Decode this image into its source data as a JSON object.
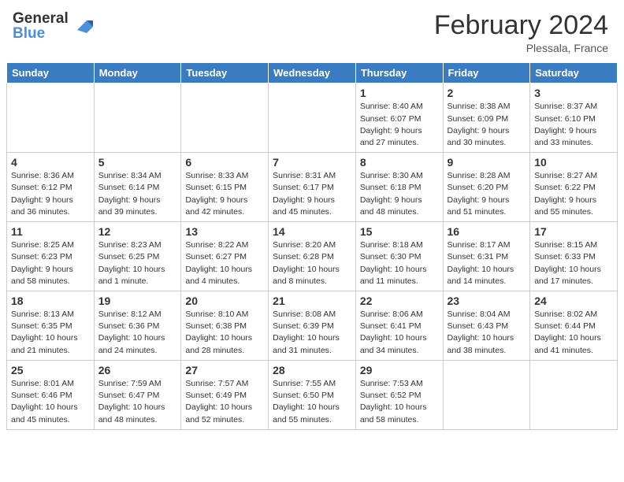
{
  "header": {
    "logo_general": "General",
    "logo_blue": "Blue",
    "title": "February 2024",
    "subtitle": "Plessala, France"
  },
  "calendar": {
    "days_of_week": [
      "Sunday",
      "Monday",
      "Tuesday",
      "Wednesday",
      "Thursday",
      "Friday",
      "Saturday"
    ],
    "weeks": [
      [
        {
          "day": "",
          "info": ""
        },
        {
          "day": "",
          "info": ""
        },
        {
          "day": "",
          "info": ""
        },
        {
          "day": "",
          "info": ""
        },
        {
          "day": "1",
          "info": "Sunrise: 8:40 AM\nSunset: 6:07 PM\nDaylight: 9 hours\nand 27 minutes."
        },
        {
          "day": "2",
          "info": "Sunrise: 8:38 AM\nSunset: 6:09 PM\nDaylight: 9 hours\nand 30 minutes."
        },
        {
          "day": "3",
          "info": "Sunrise: 8:37 AM\nSunset: 6:10 PM\nDaylight: 9 hours\nand 33 minutes."
        }
      ],
      [
        {
          "day": "4",
          "info": "Sunrise: 8:36 AM\nSunset: 6:12 PM\nDaylight: 9 hours\nand 36 minutes."
        },
        {
          "day": "5",
          "info": "Sunrise: 8:34 AM\nSunset: 6:14 PM\nDaylight: 9 hours\nand 39 minutes."
        },
        {
          "day": "6",
          "info": "Sunrise: 8:33 AM\nSunset: 6:15 PM\nDaylight: 9 hours\nand 42 minutes."
        },
        {
          "day": "7",
          "info": "Sunrise: 8:31 AM\nSunset: 6:17 PM\nDaylight: 9 hours\nand 45 minutes."
        },
        {
          "day": "8",
          "info": "Sunrise: 8:30 AM\nSunset: 6:18 PM\nDaylight: 9 hours\nand 48 minutes."
        },
        {
          "day": "9",
          "info": "Sunrise: 8:28 AM\nSunset: 6:20 PM\nDaylight: 9 hours\nand 51 minutes."
        },
        {
          "day": "10",
          "info": "Sunrise: 8:27 AM\nSunset: 6:22 PM\nDaylight: 9 hours\nand 55 minutes."
        }
      ],
      [
        {
          "day": "11",
          "info": "Sunrise: 8:25 AM\nSunset: 6:23 PM\nDaylight: 9 hours\nand 58 minutes."
        },
        {
          "day": "12",
          "info": "Sunrise: 8:23 AM\nSunset: 6:25 PM\nDaylight: 10 hours\nand 1 minute."
        },
        {
          "day": "13",
          "info": "Sunrise: 8:22 AM\nSunset: 6:27 PM\nDaylight: 10 hours\nand 4 minutes."
        },
        {
          "day": "14",
          "info": "Sunrise: 8:20 AM\nSunset: 6:28 PM\nDaylight: 10 hours\nand 8 minutes."
        },
        {
          "day": "15",
          "info": "Sunrise: 8:18 AM\nSunset: 6:30 PM\nDaylight: 10 hours\nand 11 minutes."
        },
        {
          "day": "16",
          "info": "Sunrise: 8:17 AM\nSunset: 6:31 PM\nDaylight: 10 hours\nand 14 minutes."
        },
        {
          "day": "17",
          "info": "Sunrise: 8:15 AM\nSunset: 6:33 PM\nDaylight: 10 hours\nand 17 minutes."
        }
      ],
      [
        {
          "day": "18",
          "info": "Sunrise: 8:13 AM\nSunset: 6:35 PM\nDaylight: 10 hours\nand 21 minutes."
        },
        {
          "day": "19",
          "info": "Sunrise: 8:12 AM\nSunset: 6:36 PM\nDaylight: 10 hours\nand 24 minutes."
        },
        {
          "day": "20",
          "info": "Sunrise: 8:10 AM\nSunset: 6:38 PM\nDaylight: 10 hours\nand 28 minutes."
        },
        {
          "day": "21",
          "info": "Sunrise: 8:08 AM\nSunset: 6:39 PM\nDaylight: 10 hours\nand 31 minutes."
        },
        {
          "day": "22",
          "info": "Sunrise: 8:06 AM\nSunset: 6:41 PM\nDaylight: 10 hours\nand 34 minutes."
        },
        {
          "day": "23",
          "info": "Sunrise: 8:04 AM\nSunset: 6:43 PM\nDaylight: 10 hours\nand 38 minutes."
        },
        {
          "day": "24",
          "info": "Sunrise: 8:02 AM\nSunset: 6:44 PM\nDaylight: 10 hours\nand 41 minutes."
        }
      ],
      [
        {
          "day": "25",
          "info": "Sunrise: 8:01 AM\nSunset: 6:46 PM\nDaylight: 10 hours\nand 45 minutes."
        },
        {
          "day": "26",
          "info": "Sunrise: 7:59 AM\nSunset: 6:47 PM\nDaylight: 10 hours\nand 48 minutes."
        },
        {
          "day": "27",
          "info": "Sunrise: 7:57 AM\nSunset: 6:49 PM\nDaylight: 10 hours\nand 52 minutes."
        },
        {
          "day": "28",
          "info": "Sunrise: 7:55 AM\nSunset: 6:50 PM\nDaylight: 10 hours\nand 55 minutes."
        },
        {
          "day": "29",
          "info": "Sunrise: 7:53 AM\nSunset: 6:52 PM\nDaylight: 10 hours\nand 58 minutes."
        },
        {
          "day": "",
          "info": ""
        },
        {
          "day": "",
          "info": ""
        }
      ]
    ]
  }
}
